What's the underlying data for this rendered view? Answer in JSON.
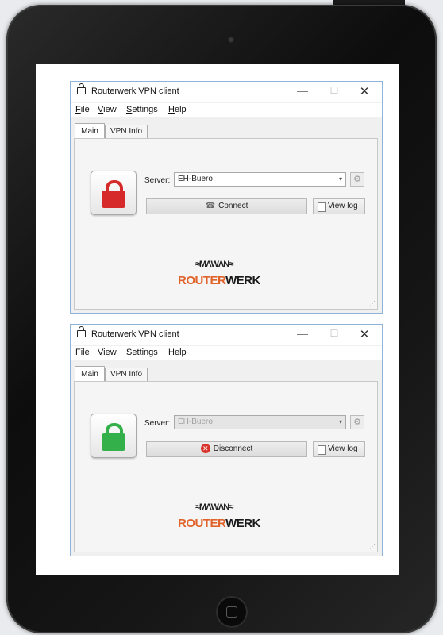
{
  "colors": {
    "locked_red": "#d62a2a",
    "unlocked_green": "#33b04a",
    "brand_orange": "#e0632a",
    "window_border": "#8fb2d8"
  },
  "windows": [
    {
      "state": "disconnected",
      "title": "Routerwerk VPN client",
      "controls": {
        "minimize": "—",
        "maximize": "☐",
        "close": "✕"
      },
      "menu": {
        "file": "File",
        "view": "View",
        "settings": "Settings",
        "help": "Help"
      },
      "tabs": {
        "main": "Main",
        "vpn_info": "VPN Info"
      },
      "server_label": "Server:",
      "server_value": "EH-Buero",
      "server_arrow": "▾",
      "connect_icon": "☎",
      "connect_label": "Connect",
      "view_log_label": "View log",
      "logo_wave": "≈MΛWΛN≈",
      "logo_r": "ROUTER",
      "logo_w": "WERK",
      "grip": "⋰"
    },
    {
      "state": "connected",
      "title": "Routerwerk VPN client",
      "controls": {
        "minimize": "—",
        "maximize": "☐",
        "close": "✕"
      },
      "menu": {
        "file": "File",
        "view": "View",
        "settings": "Settings",
        "help": "Help"
      },
      "tabs": {
        "main": "Main",
        "vpn_info": "VPN Info"
      },
      "server_label": "Server:",
      "server_value": "EH-Buero",
      "server_arrow": "▾",
      "disconnect_icon": "✕",
      "connect_label": "Disconnect",
      "view_log_label": "View log",
      "logo_wave": "≈MΛWΛN≈",
      "logo_r": "ROUTER",
      "logo_w": "WERK",
      "grip": "⋰"
    }
  ]
}
